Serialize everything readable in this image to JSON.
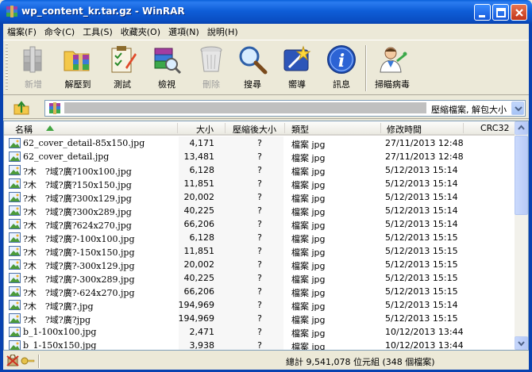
{
  "window": {
    "title": "wp_content_kr.tar.gz - WinRAR"
  },
  "menu": [
    {
      "label": "檔案(F)"
    },
    {
      "label": "命令(C)"
    },
    {
      "label": "工具(S)"
    },
    {
      "label": "收藏夾(O)"
    },
    {
      "label": "選項(N)"
    },
    {
      "label": "說明(H)"
    }
  ],
  "toolbar": {
    "add": "新增",
    "extract": "解壓到",
    "test": "測試",
    "view": "檢視",
    "delete": "刪除",
    "find": "搜尋",
    "wizard": "嚮導",
    "info": "訊息",
    "virus_scan": "掃瞄病毒"
  },
  "address": {
    "text": "壓縮檔案, 解包大小"
  },
  "columns": {
    "name": "名稱",
    "size": "大小",
    "packed": "壓縮後大小",
    "type": "類型",
    "modified": "修改時間",
    "crc": "CRC32"
  },
  "files": [
    {
      "name": "62_cover_detail-85x150.jpg",
      "size": "4,171",
      "packed": "?",
      "type": "檔案 jpg",
      "modified": "27/11/2013 12:48"
    },
    {
      "name": "62_cover_detail.jpg",
      "size": "13,481",
      "packed": "?",
      "type": "檔案 jpg",
      "modified": "27/11/2013 12:48"
    },
    {
      "name": "?木　?域?廣?100x100.jpg",
      "size": "6,128",
      "packed": "?",
      "type": "檔案 jpg",
      "modified": "5/12/2013 15:14"
    },
    {
      "name": "?木　?域?廣?150x150.jpg",
      "size": "11,851",
      "packed": "?",
      "type": "檔案 jpg",
      "modified": "5/12/2013 15:14"
    },
    {
      "name": "?木　?域?廣?300x129.jpg",
      "size": "20,002",
      "packed": "?",
      "type": "檔案 jpg",
      "modified": "5/12/2013 15:14"
    },
    {
      "name": "?木　?域?廣?300x289.jpg",
      "size": "40,225",
      "packed": "?",
      "type": "檔案 jpg",
      "modified": "5/12/2013 15:14"
    },
    {
      "name": "?木　?域?廣?624x270.jpg",
      "size": "66,206",
      "packed": "?",
      "type": "檔案 jpg",
      "modified": "5/12/2013 15:14"
    },
    {
      "name": "?木　?域?廣?-100x100.jpg",
      "size": "6,128",
      "packed": "?",
      "type": "檔案 jpg",
      "modified": "5/12/2013 15:15"
    },
    {
      "name": "?木　?域?廣?-150x150.jpg",
      "size": "11,851",
      "packed": "?",
      "type": "檔案 jpg",
      "modified": "5/12/2013 15:15"
    },
    {
      "name": "?木　?域?廣?-300x129.jpg",
      "size": "20,002",
      "packed": "?",
      "type": "檔案 jpg",
      "modified": "5/12/2013 15:15"
    },
    {
      "name": "?木　?域?廣?-300x289.jpg",
      "size": "40,225",
      "packed": "?",
      "type": "檔案 jpg",
      "modified": "5/12/2013 15:15"
    },
    {
      "name": "?木　?域?廣?-624x270.jpg",
      "size": "66,206",
      "packed": "?",
      "type": "檔案 jpg",
      "modified": "5/12/2013 15:15"
    },
    {
      "name": "?木　?域?廣?.jpg",
      "size": "194,969",
      "packed": "?",
      "type": "檔案 jpg",
      "modified": "5/12/2013 15:14"
    },
    {
      "name": "?木　?域?廣?jpg",
      "size": "194,969",
      "packed": "?",
      "type": "檔案 jpg",
      "modified": "5/12/2013 15:15"
    },
    {
      "name": "b_1-100x100.jpg",
      "size": "2,471",
      "packed": "?",
      "type": "檔案 jpg",
      "modified": "10/12/2013 13:44"
    },
    {
      "name": "b_1-150x150.jpg",
      "size": "3,938",
      "packed": "?",
      "type": "檔案 jpg",
      "modified": "10/12/2013 13:44"
    }
  ],
  "status": {
    "total": "總計 9,541,078 位元組 (348 個檔案)"
  }
}
